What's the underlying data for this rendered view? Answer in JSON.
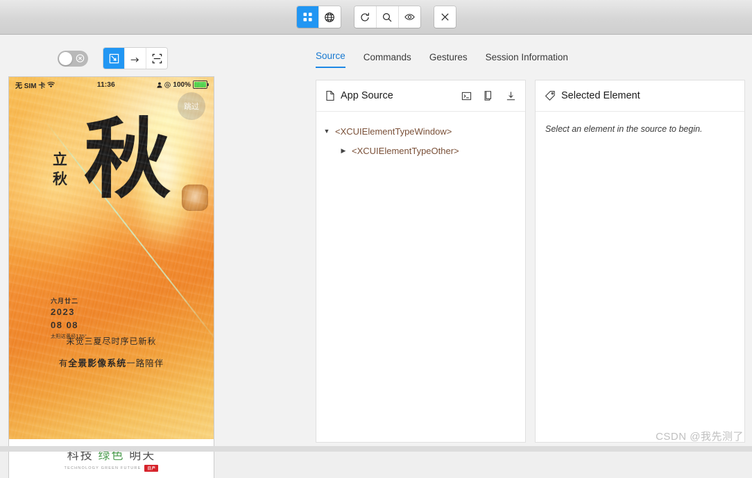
{
  "titlebar": {
    "view_buttons": [
      {
        "name": "grid-view",
        "icon": "grid-icon",
        "active": true
      },
      {
        "name": "globe-view",
        "icon": "globe-icon",
        "active": false
      }
    ],
    "action_buttons": [
      {
        "name": "refresh",
        "icon": "refresh-icon"
      },
      {
        "name": "search",
        "icon": "search-icon"
      },
      {
        "name": "inspect",
        "icon": "eye-icon"
      }
    ],
    "close_button": {
      "name": "close",
      "icon": "close-icon",
      "label": "X"
    }
  },
  "left_toolbar": {
    "toggle": {
      "label": "",
      "state": "off",
      "icon": "x-circle-icon"
    },
    "tools": [
      {
        "name": "select-tool",
        "icon": "cursor-select-icon",
        "active": true
      },
      {
        "name": "swipe-tool",
        "icon": "swipe-arrow-icon",
        "active": false
      },
      {
        "name": "tap-tool",
        "icon": "crop-frame-icon",
        "active": false
      }
    ]
  },
  "phone": {
    "statusbar": {
      "carrier": "无 SIM 卡",
      "wifi_icon": "wifi-icon",
      "time": "11:36",
      "person_icon": "person-icon",
      "at_icon": "at-icon",
      "battery_percent": "100%",
      "battery_icon": "battery-charging-icon"
    },
    "skip_label": "跳过",
    "big_character": "秋",
    "brush_text": "立\n秋",
    "date": {
      "lunar": "六月廿二",
      "year": "2023",
      "month_day": "08 08",
      "solar_term": "太阳达黄经135°"
    },
    "slogan_line1": "未觉三夏尽时序已新秋",
    "slogan_line2_pre": "有",
    "slogan_line2_bold": "全景影像系统",
    "slogan_line2_post": "一路陪伴",
    "footer": {
      "main_1": "科技",
      "main_2": "绿色",
      "main_3": "明天",
      "sub": "TECHNOLOGY GREEN FUTURE",
      "logo": "日产"
    }
  },
  "tabs": [
    {
      "label": "Source",
      "active": true
    },
    {
      "label": "Commands",
      "active": false
    },
    {
      "label": "Gestures",
      "active": false
    },
    {
      "label": "Session Information",
      "active": false
    }
  ],
  "source_panel": {
    "title": "App Source",
    "title_icon": "file-icon",
    "actions": [
      {
        "name": "terminal-action",
        "icon": "terminal-icon"
      },
      {
        "name": "copy-action",
        "icon": "copy-icon"
      },
      {
        "name": "download-action",
        "icon": "download-icon"
      }
    ],
    "tree": [
      {
        "label": "<XCUIElementTypeWindow>",
        "expanded": true,
        "depth": 0
      },
      {
        "label": "<XCUIElementTypeOther>",
        "expanded": false,
        "depth": 1
      }
    ]
  },
  "selected_panel": {
    "title": "Selected Element",
    "title_icon": "tag-icon",
    "empty_message": "Select an element in the source to begin."
  },
  "watermark": "CSDN @我先测了",
  "colors": {
    "accent": "#2196f3",
    "tab_active": "#1778d0",
    "tree_text": "#7a5038"
  }
}
